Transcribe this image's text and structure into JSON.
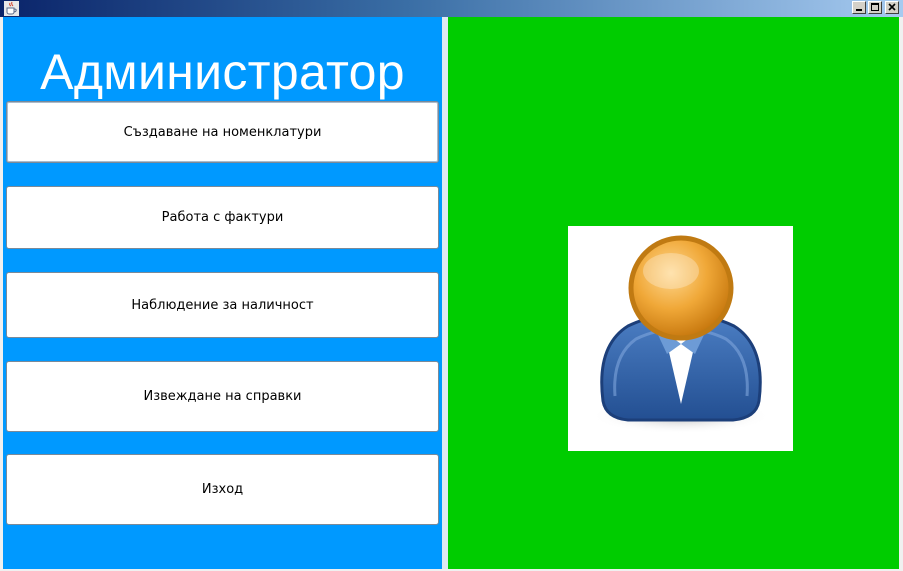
{
  "window": {
    "title": "",
    "app_icon": "java-cup-icon",
    "controls": [
      "minimize-icon",
      "maximize-icon",
      "close-icon"
    ],
    "titlebar_colors": [
      "#0a246a",
      "#a6caf0"
    ]
  },
  "sidebar": {
    "title": "Администратор",
    "background": "#0099ff",
    "buttons": [
      {
        "label": "Създаване на номенклатури"
      },
      {
        "label": "Работа с фактури"
      },
      {
        "label": "Наблюдение за наличност"
      },
      {
        "label": "Извеждане на справки"
      },
      {
        "label": "Изход"
      }
    ]
  },
  "main": {
    "background": "#00cc00",
    "image": "user-avatar-icon"
  }
}
